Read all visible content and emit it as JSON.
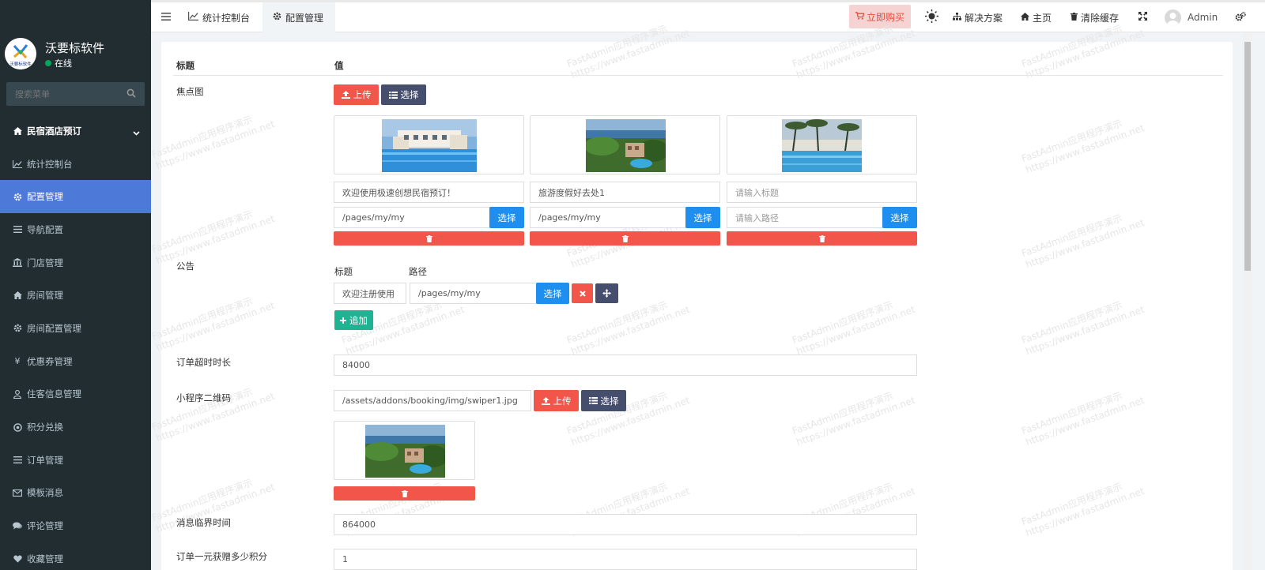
{
  "sidebar": {
    "brand_name": "沃要标软件",
    "status": "在线",
    "logo_text": "沃要标软件",
    "search_placeholder": "搜索菜单",
    "items": [
      {
        "label": "民宿酒店预订",
        "icon": "home-icon"
      },
      {
        "label": "统计控制台",
        "icon": "chart-icon"
      },
      {
        "label": "配置管理",
        "icon": "gear-icon"
      },
      {
        "label": "导航配置",
        "icon": "list-icon"
      },
      {
        "label": "门店管理",
        "icon": "bank-icon"
      },
      {
        "label": "房间管理",
        "icon": "home-icon"
      },
      {
        "label": "房间配置管理",
        "icon": "gear-icon"
      },
      {
        "label": "优惠券管理",
        "icon": "yen-icon"
      },
      {
        "label": "住客信息管理",
        "icon": "user-icon"
      },
      {
        "label": "积分兑换",
        "icon": "circle-icon"
      },
      {
        "label": "订单管理",
        "icon": "list-icon"
      },
      {
        "label": "模板消息",
        "icon": "mail-icon"
      },
      {
        "label": "评论管理",
        "icon": "comments-icon"
      },
      {
        "label": "收藏管理",
        "icon": "heart-icon"
      }
    ]
  },
  "topbar": {
    "tab_dashboard": "统计控制台",
    "tab_config": "配置管理",
    "buy": "立即购买",
    "solutions": "解决方案",
    "home": "主页",
    "clear_cache": "清除缓存",
    "user": "Admin"
  },
  "content": {
    "col_title": "标题",
    "col_value": "值",
    "focus_label": "焦点图",
    "upload": "上传",
    "select": "选择",
    "slides": [
      {
        "title": "欢迎使用极速创想民宿预订！",
        "title_ph": "请输入标题",
        "path": "/pages/my/my",
        "path_ph": "请输入路径"
      },
      {
        "title": "旅游度假好去处1",
        "title_ph": "请输入标题",
        "path": "/pages/my/my",
        "path_ph": "请输入路径"
      },
      {
        "title": "",
        "title_ph": "请输入标题",
        "path": "",
        "path_ph": "请输入路径"
      }
    ],
    "notice_label": "公告",
    "notice_col_title": "标题",
    "notice_col_path": "路径",
    "notice_title": "欢迎注册使用",
    "notice_path": "/pages/my/my",
    "add": "追加",
    "timeout_label": "订单超时时长",
    "timeout_value": "84000",
    "qrcode_label": "小程序二维码",
    "qrcode_value": "/assets/addons/booking/img/swiper1.jpg",
    "msg_label": "消息临界时间",
    "msg_value": "864000",
    "points_label": "订单一元获赠多少积分",
    "points_value": "1"
  },
  "watermark": {
    "line1": "FastAdmin应用程序演示",
    "line2": "https://www.fastadmin.net"
  },
  "colors": {
    "sidebar_bg": "#222d32",
    "active": "#4d79d9",
    "danger": "#f2564a",
    "info": "#1e8eef",
    "dark": "#464e6e",
    "success": "#1fb394"
  }
}
